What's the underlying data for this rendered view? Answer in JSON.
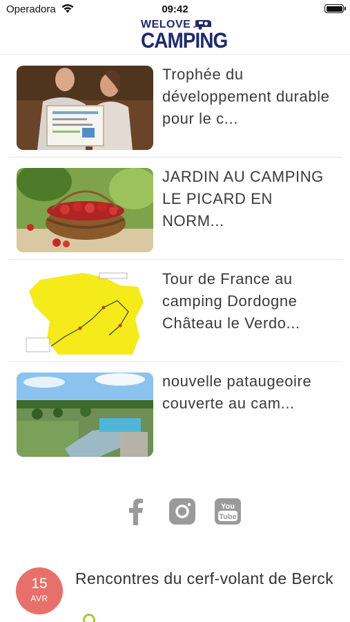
{
  "status_bar": {
    "carrier": "Operadora",
    "time": "09:42"
  },
  "header": {
    "logo_top": "WELOVE",
    "logo_main": "CAMPING"
  },
  "articles": [
    {
      "title": "Trophée du développement durable pour le c...",
      "image": "award-photo"
    },
    {
      "title": "JARDIN AU CAMPING LE PICARD EN NORM...",
      "image": "strawberries-photo"
    },
    {
      "title": "Tour de France au camping Dordogne Château le Verdo...",
      "image": "france-map"
    },
    {
      "title": "nouvelle pataugeoire couverte au cam...",
      "image": "campsite-aerial"
    }
  ],
  "social": {
    "facebook": "facebook-icon",
    "instagram": "instagram-icon",
    "youtube": "youtube-icon",
    "youtube_text_top": "You",
    "youtube_text_bottom": "Tube",
    "color": "#9a9a9a"
  },
  "event": {
    "day": "15",
    "month": "AVR",
    "title": "Rencontres du cerf-volant de Berck",
    "badge_color": "#e7706b"
  },
  "colors": {
    "brand": "#1f2a6b",
    "text": "#3a3a3a",
    "divider": "#e8e8e8"
  }
}
